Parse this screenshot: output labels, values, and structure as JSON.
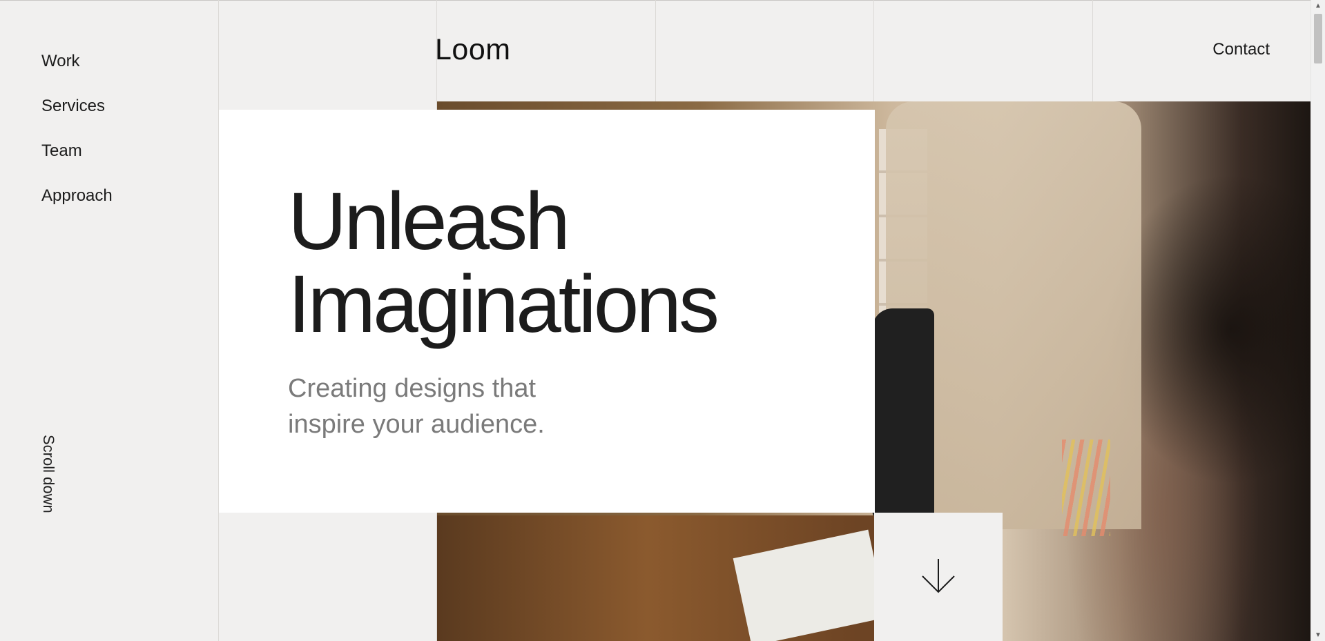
{
  "nav": {
    "items": [
      {
        "label": "Work"
      },
      {
        "label": "Services"
      },
      {
        "label": "Team"
      },
      {
        "label": "Approach"
      }
    ]
  },
  "header": {
    "logo": "Loom",
    "contact_label": "Contact"
  },
  "hero": {
    "title_line1": "Unleash",
    "title_line2": "Imaginations",
    "subtitle": "Creating designs that inspire your audience."
  },
  "scroll": {
    "label": "Scroll down",
    "button_icon": "arrow-down-icon"
  },
  "colors": {
    "background": "#f1f0ef",
    "card": "#ffffff",
    "text": "#1b1b1b",
    "muted": "#7a7a7a"
  }
}
